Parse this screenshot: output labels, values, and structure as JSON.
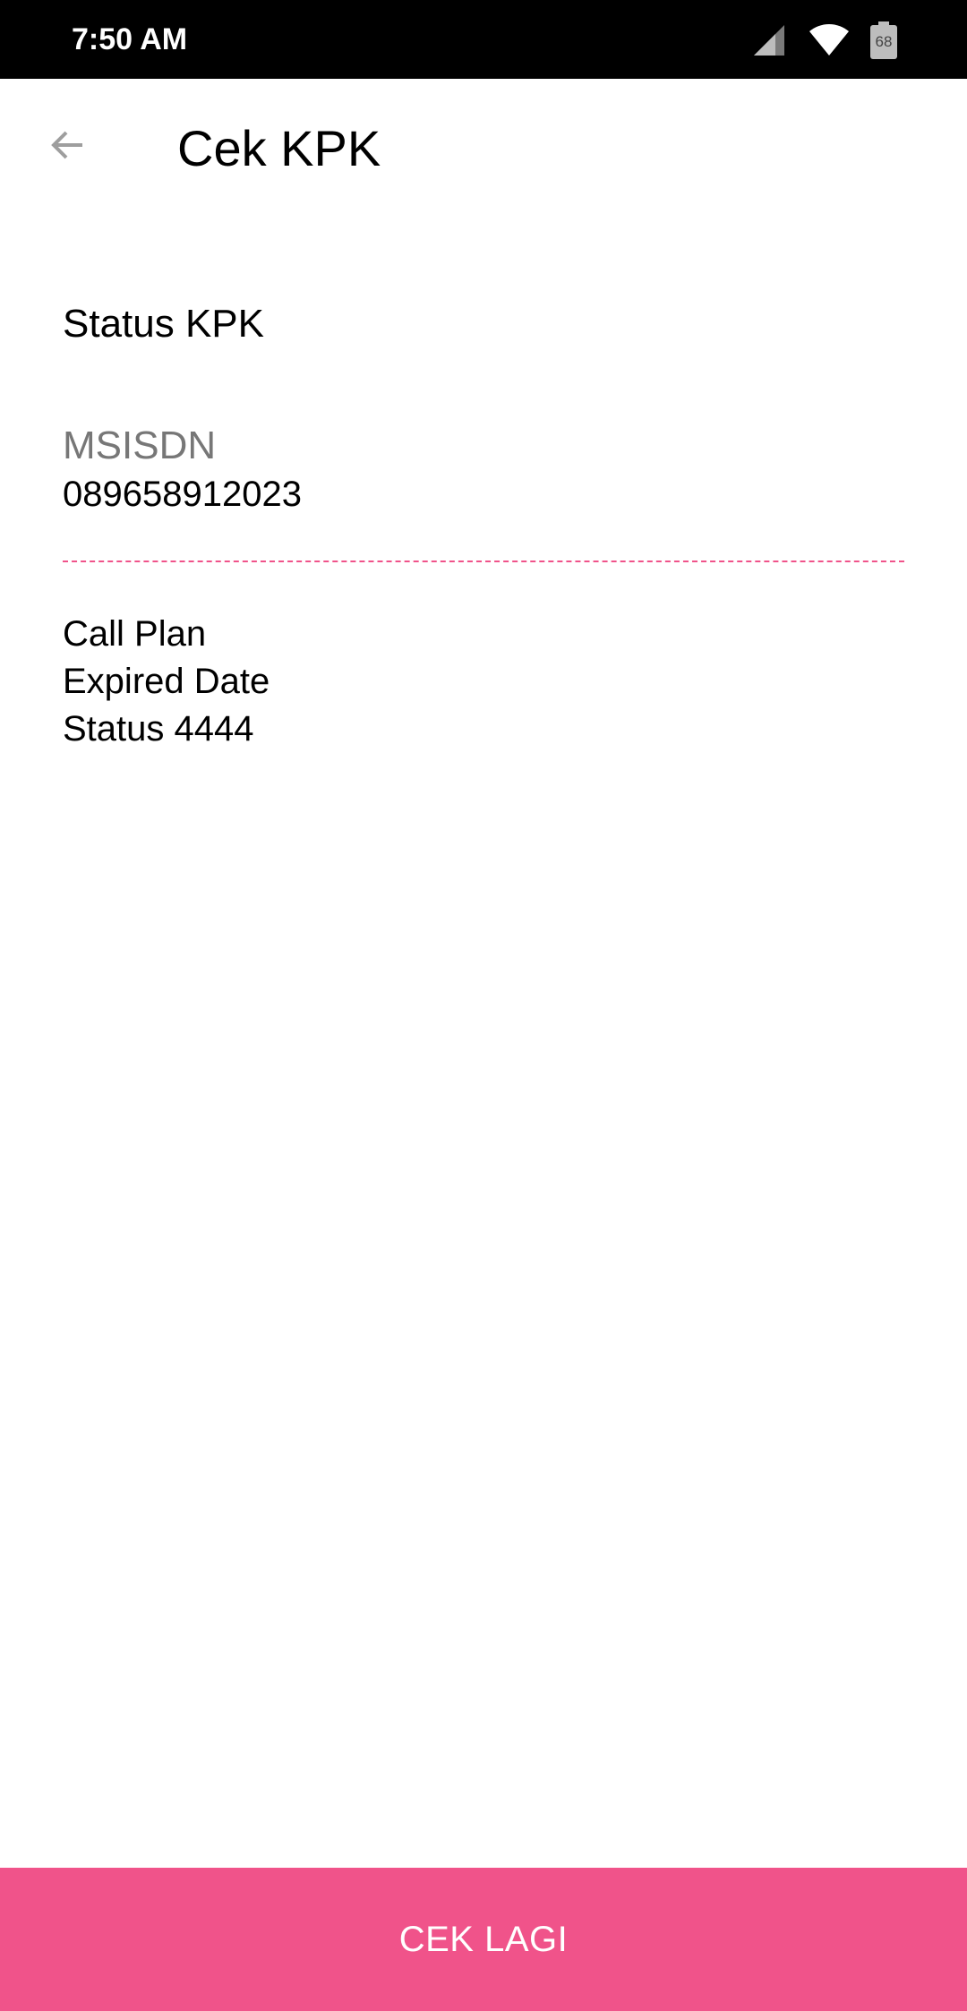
{
  "status_bar": {
    "time": "7:50 AM",
    "battery_level": "68",
    "icons": [
      "signal-icon",
      "wifi-icon",
      "battery-icon"
    ]
  },
  "toolbar": {
    "title": "Cek KPK",
    "back_icon": "arrow-left-icon"
  },
  "content": {
    "section_title": "Status KPK",
    "msisdn_label": "MSISDN",
    "msisdn_value": "089658912023",
    "info_items": [
      "Call Plan",
      "Expired Date",
      "Status 4444"
    ]
  },
  "footer": {
    "button_label": "CEK LAGI"
  },
  "colors": {
    "accent": "#f0538a",
    "status_bar": "#000000",
    "muted_text": "#777777"
  }
}
